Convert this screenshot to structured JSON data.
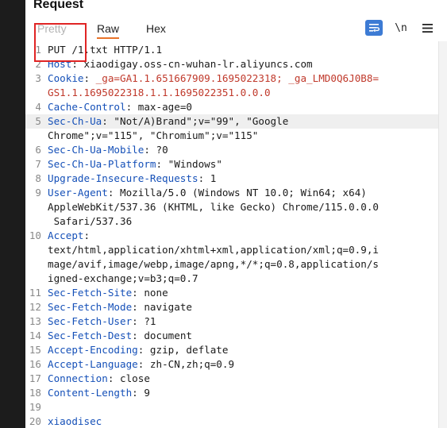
{
  "panel": {
    "title": "Request",
    "tabs": [
      {
        "label": "Pretty",
        "active": false
      },
      {
        "label": "Raw",
        "active": true
      },
      {
        "label": "Hex",
        "active": false
      }
    ],
    "toolbar": {
      "wrap_icon": "word-wrap-icon",
      "newline_label": "\\n",
      "menu_icon": "hamburger-menu-icon"
    }
  },
  "colors": {
    "header_name": "#1550b8",
    "cookie_value": "#c0392b",
    "tab_underline": "#e8732a",
    "wrap_button": "#3d7bd4",
    "annotation_box": "#e02424"
  },
  "editor": {
    "current_line": 5,
    "rows": [
      {
        "num": "1",
        "text": "PUT /1.txt HTTP/1.1"
      },
      {
        "num": "2",
        "name": "Host",
        "value": "xiaodigay.oss-cn-wuhan-lr.aliyuncs.com"
      },
      {
        "num": "3",
        "name": "Cookie",
        "cookie": "_ga=GA1.1.651667909.1695022318; _ga_LMD0Q6J0B8="
      },
      {
        "num": "",
        "cookie": "GS1.1.1695022318.1.1.1695022351.0.0.0"
      },
      {
        "num": "4",
        "name": "Cache-Control",
        "value": "max-age=0"
      },
      {
        "num": "5",
        "name": "Sec-Ch-Ua",
        "value": "\"Not/A)Brand\";v=\"99\", \"Google"
      },
      {
        "num": "",
        "text": "Chrome\";v=\"115\", \"Chromium\";v=\"115\""
      },
      {
        "num": "6",
        "name": "Sec-Ch-Ua-Mobile",
        "value": "?0"
      },
      {
        "num": "7",
        "name": "Sec-Ch-Ua-Platform",
        "value": "\"Windows\""
      },
      {
        "num": "8",
        "name": "Upgrade-Insecure-Requests",
        "value": "1"
      },
      {
        "num": "9",
        "name": "User-Agent",
        "value": "Mozilla/5.0 (Windows NT 10.0; Win64; x64)"
      },
      {
        "num": "",
        "text": "AppleWebKit/537.36 (KHTML, like Gecko) Chrome/115.0.0.0"
      },
      {
        "num": "",
        "text": " Safari/537.36"
      },
      {
        "num": "10",
        "name": "Accept",
        "value": ""
      },
      {
        "num": "",
        "text": "text/html,application/xhtml+xml,application/xml;q=0.9,i"
      },
      {
        "num": "",
        "text": "mage/avif,image/webp,image/apng,*/*;q=0.8,application/s"
      },
      {
        "num": "",
        "text": "igned-exchange;v=b3;q=0.7"
      },
      {
        "num": "11",
        "name": "Sec-Fetch-Site",
        "value": "none"
      },
      {
        "num": "12",
        "name": "Sec-Fetch-Mode",
        "value": "navigate"
      },
      {
        "num": "13",
        "name": "Sec-Fetch-User",
        "value": "?1"
      },
      {
        "num": "14",
        "name": "Sec-Fetch-Dest",
        "value": "document"
      },
      {
        "num": "15",
        "name": "Accept-Encoding",
        "value": "gzip, deflate"
      },
      {
        "num": "16",
        "name": "Accept-Language",
        "value": "zh-CN,zh;q=0.9"
      },
      {
        "num": "17",
        "name": "Connection",
        "value": "close"
      },
      {
        "num": "18",
        "name": "Content-Length",
        "value": "9"
      },
      {
        "num": "19",
        "text": ""
      },
      {
        "num": "20",
        "body": "xiaodisec"
      }
    ]
  }
}
